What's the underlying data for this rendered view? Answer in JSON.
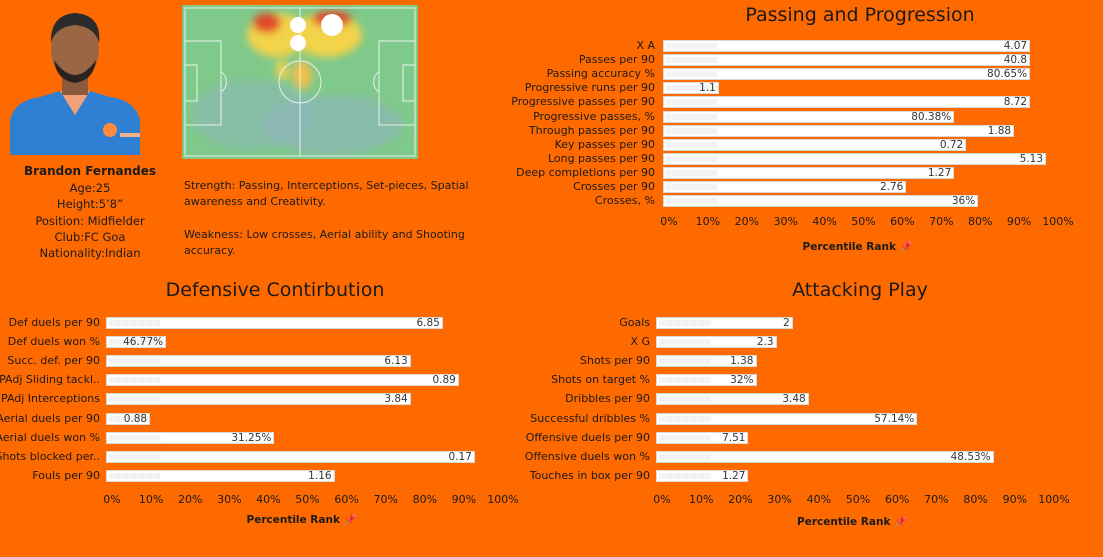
{
  "player": {
    "name": "Brandon Fernandes",
    "age": "Age:25",
    "height": "Height:5’8”",
    "position": "Position: Midfielder",
    "club": "Club:FC Goa",
    "nationality": "Nationality:Indian",
    "photo_icon": "player-photo",
    "colors": {
      "background": "#ff6a00",
      "jersey": "#2f7fd3",
      "bar": "#ffffff"
    }
  },
  "notes": {
    "strength": "Strength: Passing, Interceptions, Set-pieces, Spatial awareness and Creativity.",
    "weakness": "Weakness: Low crosses, Aerial ability and Shooting accuracy."
  },
  "heatmap": {
    "label": "Player heatmap",
    "markers": 3
  },
  "chart_data": [
    {
      "type": "bar",
      "orientation": "horizontal",
      "title": "Passing and Progression",
      "xlabel": "Percentile Rank",
      "xlim": [
        0,
        100
      ],
      "ticks": [
        "0%",
        "10%",
        "20%",
        "30%",
        "40%",
        "50%",
        "60%",
        "70%",
        "80%",
        "90%",
        "100%"
      ],
      "categories": [
        "X A",
        "Passes per 90",
        "Passing accuracy %",
        "Progressive runs per 90",
        "Progressive passes per 90",
        "Progressive passes, %",
        "Through passes per 90",
        "Key passes per 90",
        "Long passes per 90",
        "Deep completions per 90",
        "Crosses per 90",
        "Crosses, %"
      ],
      "percentiles": [
        92,
        92,
        92,
        14,
        92,
        73,
        88,
        76,
        96,
        73,
        61,
        79
      ],
      "labels": [
        "4.07",
        "40.8",
        "80.65%",
        "1.1",
        "8.72",
        "80.38%",
        "1.88",
        "0.72",
        "5.13",
        "1.27",
        "2.76",
        "36%"
      ]
    },
    {
      "type": "bar",
      "orientation": "horizontal",
      "title": "Defensive Contirbution",
      "xlabel": "Percentile Rank",
      "xlim": [
        0,
        100
      ],
      "ticks": [
        "0%",
        "10%",
        "20%",
        "30%",
        "40%",
        "50%",
        "60%",
        "70%",
        "80%",
        "90%",
        "100%"
      ],
      "categories": [
        "Def duels per 90",
        "Def duels won %",
        "Succ. def. per 90",
        "PAdj Sliding tackl..",
        "PAdj Interceptions",
        "Aerial duels per 90",
        "Aerial duels won %",
        "Shots blocked per..",
        "Fouls per 90"
      ],
      "percentiles": [
        84,
        15,
        76,
        88,
        76,
        11,
        42,
        92,
        57
      ],
      "labels": [
        "6.85",
        "46.77%",
        "6.13",
        "0.89",
        "3.84",
        "0.88",
        "31.25%",
        "0.17",
        "1.16"
      ]
    },
    {
      "type": "bar",
      "orientation": "horizontal",
      "title": "Attacking Play",
      "xlabel": "Percentile Rank",
      "xlim": [
        0,
        100
      ],
      "ticks": [
        "0%",
        "10%",
        "20%",
        "30%",
        "40%",
        "50%",
        "60%",
        "70%",
        "80%",
        "90%",
        "100%"
      ],
      "categories": [
        "Goals",
        "X G",
        "Shots per 90",
        "Shots on target %",
        "Dribbles per 90",
        "Successful dribbles %",
        "Offensive duels per 90",
        "Offensive duels won %",
        "Touches in box per 90"
      ],
      "percentiles": [
        34,
        30,
        25,
        25,
        38,
        65,
        23,
        84,
        23
      ],
      "labels": [
        "2",
        "2.3",
        "1.38",
        "32%",
        "3.48",
        "57.14%",
        "7.51",
        "48.53%",
        "1.27"
      ]
    }
  ]
}
